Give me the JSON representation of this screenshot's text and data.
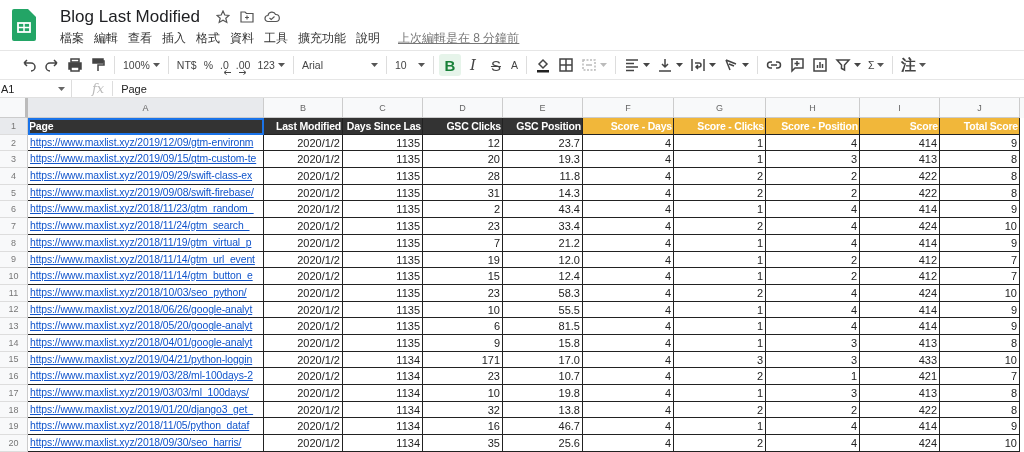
{
  "doc": {
    "title": "Blog Last Modified",
    "menu": [
      "檔案",
      "編輯",
      "查看",
      "插入",
      "格式",
      "資料",
      "工具",
      "擴充功能",
      "說明"
    ],
    "last_edit": "上次編輯是在 8 分鐘前"
  },
  "toolbar": [
    {
      "kind": "undo"
    },
    {
      "kind": "redo"
    },
    {
      "kind": "print"
    },
    {
      "kind": "paint"
    },
    {
      "kind": "sep"
    },
    {
      "kind": "text",
      "label": "100%",
      "menu": true
    },
    {
      "kind": "sep"
    },
    {
      "kind": "text",
      "label": "NT$",
      "menu": false
    },
    {
      "kind": "text",
      "label": "%",
      "menu": false
    },
    {
      "kind": "dec-down",
      "label": ".0"
    },
    {
      "kind": "dec-up",
      "label": ".00"
    },
    {
      "kind": "text",
      "label": "123",
      "menu": true
    },
    {
      "kind": "sep"
    },
    {
      "kind": "font",
      "label": "Arial",
      "menu": true
    },
    {
      "kind": "sep"
    },
    {
      "kind": "size",
      "label": "10",
      "menu": true
    },
    {
      "kind": "sep"
    },
    {
      "kind": "bold",
      "label": "B",
      "selected": true
    },
    {
      "kind": "italic",
      "label": "I",
      "selected": false
    },
    {
      "kind": "strike",
      "label": "S",
      "selected": false
    },
    {
      "kind": "text",
      "label": "A",
      "menu": false
    },
    {
      "kind": "sep"
    },
    {
      "kind": "fill"
    },
    {
      "kind": "borders"
    },
    {
      "kind": "merge",
      "disabled": true
    },
    {
      "kind": "sep"
    },
    {
      "kind": "halign"
    },
    {
      "kind": "valign"
    },
    {
      "kind": "wrap"
    },
    {
      "kind": "rotate"
    },
    {
      "kind": "sep"
    },
    {
      "kind": "link"
    },
    {
      "kind": "comment"
    },
    {
      "kind": "chart"
    },
    {
      "kind": "filter"
    },
    {
      "kind": "text",
      "label": "Σ",
      "menu": true
    },
    {
      "kind": "sep"
    },
    {
      "kind": "text",
      "label": "注",
      "menu": true
    }
  ],
  "formula_bar": {
    "cell_ref": "A1",
    "fx": "fx",
    "value": "Page"
  },
  "sheet": {
    "columns": [
      {
        "letter": "A",
        "selected": true
      },
      {
        "letter": "B",
        "selected": false
      },
      {
        "letter": "C",
        "selected": false
      },
      {
        "letter": "D",
        "selected": false
      },
      {
        "letter": "E",
        "selected": false
      },
      {
        "letter": "F",
        "selected": false
      },
      {
        "letter": "G",
        "selected": false
      },
      {
        "letter": "H",
        "selected": false
      },
      {
        "letter": "I",
        "selected": false
      },
      {
        "letter": "J",
        "selected": false
      }
    ],
    "header_row": {
      "number": "1",
      "selected": true,
      "cells": [
        {
          "text": "Page",
          "color": "#333333"
        },
        {
          "text": "Last Modified",
          "color": "#333333"
        },
        {
          "text": "Days Since Las",
          "color": "#333333"
        },
        {
          "text": "GSC Clicks",
          "color": "#333333"
        },
        {
          "text": "GSC Position",
          "color": "#333333"
        },
        {
          "text": "Score - Days",
          "color": "#f1b73a"
        },
        {
          "text": "Score - Clicks",
          "color": "#f1b73a"
        },
        {
          "text": "Score - Position",
          "color": "#f1b73a"
        },
        {
          "text": "Score",
          "color": "#f1b73a"
        },
        {
          "text": "Total Score",
          "color": "#f1b73a"
        }
      ]
    },
    "rows": [
      {
        "number": "2",
        "cells": [
          "https://www.maxlist.xyz/2019/12/09/gtm-environm",
          "2020/1/2",
          "1135",
          "12",
          "23.7",
          "4",
          "1",
          "4",
          "414",
          "9"
        ]
      },
      {
        "number": "3",
        "cells": [
          "https://www.maxlist.xyz/2019/09/15/gtm-custom-te",
          "2020/1/2",
          "1135",
          "20",
          "19.3",
          "4",
          "1",
          "3",
          "413",
          "8"
        ]
      },
      {
        "number": "4",
        "cells": [
          "https://www.maxlist.xyz/2019/09/29/swift-class-ex",
          "2020/1/2",
          "1135",
          "28",
          "11.8",
          "4",
          "2",
          "2",
          "422",
          "8"
        ]
      },
      {
        "number": "5",
        "cells": [
          "https://www.maxlist.xyz/2019/09/08/swift-firebase/",
          "2020/1/2",
          "1135",
          "31",
          "14.3",
          "4",
          "2",
          "2",
          "422",
          "8"
        ]
      },
      {
        "number": "6",
        "cells": [
          "https://www.maxlist.xyz/2018/11/23/gtm_random_",
          "2020/1/2",
          "1135",
          "2",
          "43.4",
          "4",
          "1",
          "4",
          "414",
          "9"
        ]
      },
      {
        "number": "7",
        "cells": [
          "https://www.maxlist.xyz/2018/11/24/gtm_search_",
          "2020/1/2",
          "1135",
          "23",
          "33.4",
          "4",
          "2",
          "4",
          "424",
          "10"
        ]
      },
      {
        "number": "8",
        "cells": [
          "https://www.maxlist.xyz/2018/11/19/gtm_virtual_p",
          "2020/1/2",
          "1135",
          "7",
          "21.2",
          "4",
          "1",
          "4",
          "414",
          "9"
        ]
      },
      {
        "number": "9",
        "cells": [
          "https://www.maxlist.xyz/2018/11/14/gtm_url_event",
          "2020/1/2",
          "1135",
          "19",
          "12.0",
          "4",
          "1",
          "2",
          "412",
          "7"
        ]
      },
      {
        "number": "10",
        "cells": [
          "https://www.maxlist.xyz/2018/11/14/gtm_button_e",
          "2020/1/2",
          "1135",
          "15",
          "12.4",
          "4",
          "1",
          "2",
          "412",
          "7"
        ]
      },
      {
        "number": "11",
        "cells": [
          "https://www.maxlist.xyz/2018/10/03/seo_python/",
          "2020/1/2",
          "1135",
          "23",
          "58.3",
          "4",
          "2",
          "4",
          "424",
          "10"
        ]
      },
      {
        "number": "12",
        "cells": [
          "https://www.maxlist.xyz/2018/06/26/google-analyt",
          "2020/1/2",
          "1135",
          "10",
          "55.5",
          "4",
          "1",
          "4",
          "414",
          "9"
        ]
      },
      {
        "number": "13",
        "cells": [
          "https://www.maxlist.xyz/2018/05/20/google-analyt",
          "2020/1/2",
          "1135",
          "6",
          "81.5",
          "4",
          "1",
          "4",
          "414",
          "9"
        ]
      },
      {
        "number": "14",
        "cells": [
          "https://www.maxlist.xyz/2018/04/01/google-analyt",
          "2020/1/2",
          "1135",
          "9",
          "15.8",
          "4",
          "1",
          "3",
          "413",
          "8"
        ]
      },
      {
        "number": "15",
        "cells": [
          "https://www.maxlist.xyz/2019/04/21/python-loggin",
          "2020/1/2",
          "1134",
          "171",
          "17.0",
          "4",
          "3",
          "3",
          "433",
          "10"
        ]
      },
      {
        "number": "16",
        "cells": [
          "https://www.maxlist.xyz/2019/03/28/ml-100days-2",
          "2020/1/2",
          "1134",
          "23",
          "10.7",
          "4",
          "2",
          "1",
          "421",
          "7"
        ]
      },
      {
        "number": "17",
        "cells": [
          "https://www.maxlist.xyz/2019/03/03/ml_100days/",
          "2020/1/2",
          "1134",
          "10",
          "19.8",
          "4",
          "1",
          "3",
          "413",
          "8"
        ]
      },
      {
        "number": "18",
        "cells": [
          "https://www.maxlist.xyz/2019/01/20/django3_get_",
          "2020/1/2",
          "1134",
          "32",
          "13.8",
          "4",
          "2",
          "2",
          "422",
          "8"
        ]
      },
      {
        "number": "19",
        "cells": [
          "https://www.maxlist.xyz/2018/11/05/python_dataf",
          "2020/1/2",
          "1134",
          "16",
          "46.7",
          "4",
          "1",
          "4",
          "414",
          "9"
        ]
      },
      {
        "number": "20",
        "cells": [
          "https://www.maxlist.xyz/2018/09/30/seo_harris/",
          "2020/1/2",
          "1134",
          "35",
          "25.6",
          "4",
          "2",
          "4",
          "424",
          "10"
        ]
      }
    ]
  }
}
